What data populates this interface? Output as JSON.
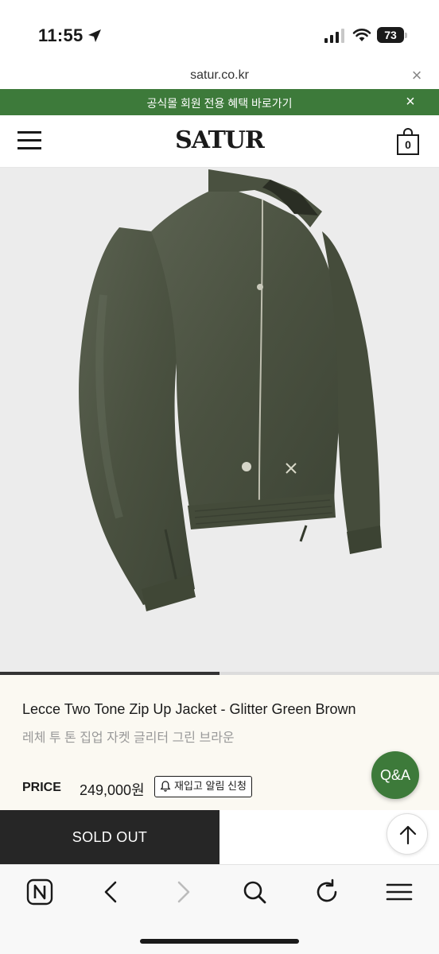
{
  "status_bar": {
    "time": "11:55",
    "battery": "73"
  },
  "browser": {
    "url": "satur.co.kr"
  },
  "promo": {
    "text": "공식몰 회원 전용 혜택 바로가기"
  },
  "header": {
    "logo": "SATUR",
    "cart_count": "0"
  },
  "gallery": {
    "progress": 0.5
  },
  "product": {
    "name": "Lecce Two Tone Zip Up Jacket - Glitter Green Brown",
    "name_kr": "레체 투 톤 집업 자켓 글리터 그린 브라운",
    "price_label": "PRICE",
    "price": "249,000원",
    "restock_label": "재입고 알림 신청"
  },
  "qa_button": {
    "label": "Q&A"
  },
  "action": {
    "sold_out_label": "SOLD OUT"
  },
  "colors": {
    "brand_green": "#3d7a3a",
    "dark": "#262626",
    "info_bg": "#fbf9f2",
    "jacket": "#4c5440"
  },
  "icons": [
    "location-arrow-icon",
    "signal-icon",
    "wifi-icon",
    "battery-icon",
    "close-icon",
    "menu-icon",
    "cart-icon",
    "bell-icon",
    "arrow-up-icon",
    "naver-icon",
    "back-icon",
    "forward-icon",
    "search-icon",
    "refresh-icon",
    "hamburger-icon"
  ]
}
